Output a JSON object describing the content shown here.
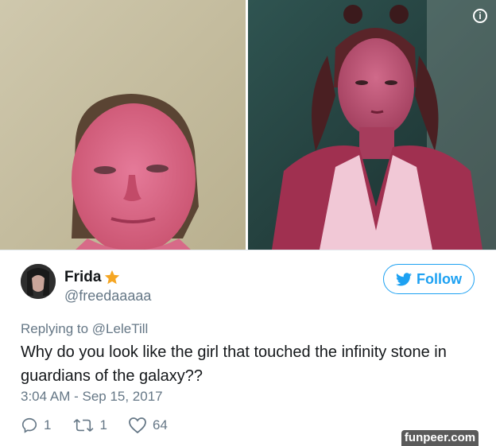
{
  "tweet": {
    "display_name": "Frida",
    "handle": "@freedaaaaa",
    "follow_label": "Follow",
    "replying_prefix": "Replying to",
    "replying_to": "@LeleTill",
    "text": "Why do you look like the girl that touched the infinity stone in guardians of the galaxy??",
    "timestamp": "3:04 AM - Sep 15, 2017",
    "reply_count": "1",
    "retweet_count": "1",
    "like_count": "64"
  },
  "media": {
    "info_label": "i"
  },
  "watermark": "funpeer.com",
  "colors": {
    "accent": "#1da1f2",
    "secondary_text": "#657786",
    "primary_text": "#14171a",
    "star": "#f5a623"
  },
  "icons": [
    "info-icon",
    "star-icon",
    "twitter-bird-icon",
    "reply-icon",
    "retweet-icon",
    "heart-icon"
  ]
}
